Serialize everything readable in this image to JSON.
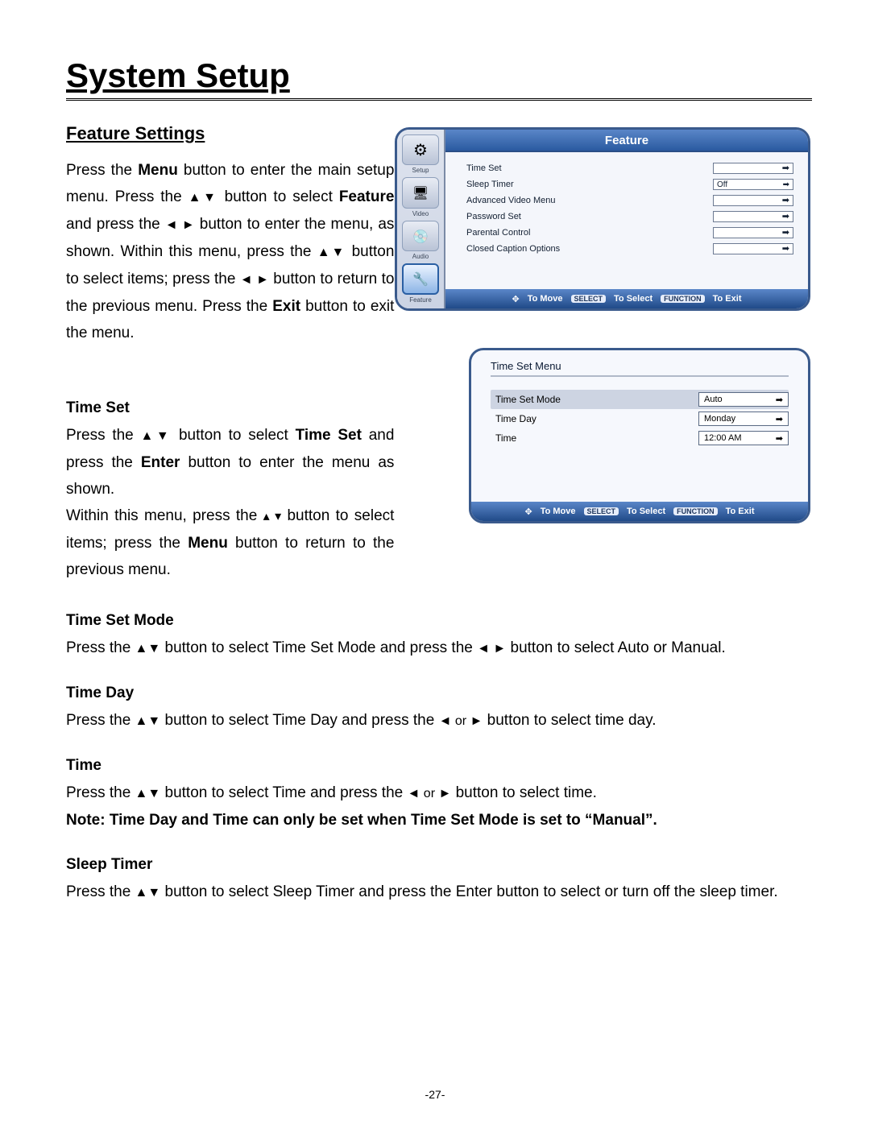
{
  "page": {
    "title": "System Setup",
    "number": "-27-"
  },
  "section": {
    "title": "Feature Settings"
  },
  "intro": {
    "t1": "Press the ",
    "b1": "Menu",
    "t2": " button to enter the main setup menu. Press the ",
    "arrows1": "▲▼",
    "t3": " button to select ",
    "b2": "Feature",
    "t4": " and press the ",
    "arrows2": "◄ ►",
    "t5": " button to enter the menu, as shown. Within this menu, press the ",
    "arrows3": "▲▼",
    "t6": " button to select items; press the ",
    "arrows4": "◄ ►",
    "t7": " button to return to the previous menu. Press the ",
    "b3": "Exit",
    "t8": " button to exit the menu."
  },
  "timeset": {
    "heading": "Time Set",
    "p1a": "Press the ",
    "arr1": "▲▼",
    "p1b": " button to select ",
    "b1": "Time Set",
    "p1c": " and press the ",
    "b2": "Enter",
    "p1d": " button to enter the menu as shown.",
    "p2a": "Within this menu, press the ",
    "arr2": "▴ ▾",
    "p2b": " button to select items; press the ",
    "b3": "Menu",
    "p2c": " button to return to the previous menu."
  },
  "mode": {
    "heading": "Time Set Mode",
    "a": "Press the ",
    "arr": "▲▼",
    "b": " button to select Time Set Mode and press the ",
    "arr2": "◄ ►",
    "c": " button to select Auto or Manual."
  },
  "day": {
    "heading": "Time Day",
    "a": "Press the ",
    "arr": "▲▼",
    "b": " button to select Time Day and press the ",
    "arr2": "◄ or ►",
    "c": " button to select time day."
  },
  "time": {
    "heading": "Time",
    "a": "Press the ",
    "arr": "▲▼",
    "b": " button to select Time and press the ",
    "arr2": "◄ or ►",
    "c": " button to select time.",
    "note": "Note: Time Day and Time can only be set when Time Set Mode is set to “Manual”."
  },
  "sleep": {
    "heading": "Sleep Timer",
    "a": "Press the ",
    "arr": "▲▼",
    "b": " button to select Sleep Timer and press the Enter button to select or turn off the sleep timer."
  },
  "osd1": {
    "title": "Feature",
    "side": [
      {
        "name": "setup-tab",
        "label": "Setup"
      },
      {
        "name": "video-tab",
        "label": "Video"
      },
      {
        "name": "audio-tab",
        "label": "Audio"
      },
      {
        "name": "feature-tab",
        "label": "Feature"
      }
    ],
    "rows": [
      {
        "label": "Time Set",
        "value": "",
        "arrow": "➡"
      },
      {
        "label": "Sleep Timer",
        "value": "Off",
        "arrow": "➡"
      },
      {
        "label": "Advanced Video Menu",
        "value": "",
        "arrow": "➡"
      },
      {
        "label": "Password Set",
        "value": "",
        "arrow": "➡"
      },
      {
        "label": "Parental Control",
        "value": "",
        "arrow": "➡"
      },
      {
        "label": "Closed Caption Options",
        "value": "",
        "arrow": "➡"
      }
    ],
    "footer": {
      "move": "To Move",
      "select_tag": "SELECT",
      "select": "To Select",
      "func_tag": "FUNCTION",
      "exit": "To Exit"
    }
  },
  "osd2": {
    "title": "Time Set Menu",
    "rows": [
      {
        "label": "Time Set Mode",
        "value": "Auto",
        "arrow": "➡",
        "selected": true
      },
      {
        "label": "Time Day",
        "value": "Monday",
        "arrow": "➡",
        "selected": false
      },
      {
        "label": "Time",
        "value": "12:00 AM",
        "arrow": "➡",
        "selected": false
      }
    ],
    "footer": {
      "move": "To Move",
      "select_tag": "SELECT",
      "select": "To Select",
      "func_tag": "FUNCTION",
      "exit": "To Exit"
    }
  }
}
